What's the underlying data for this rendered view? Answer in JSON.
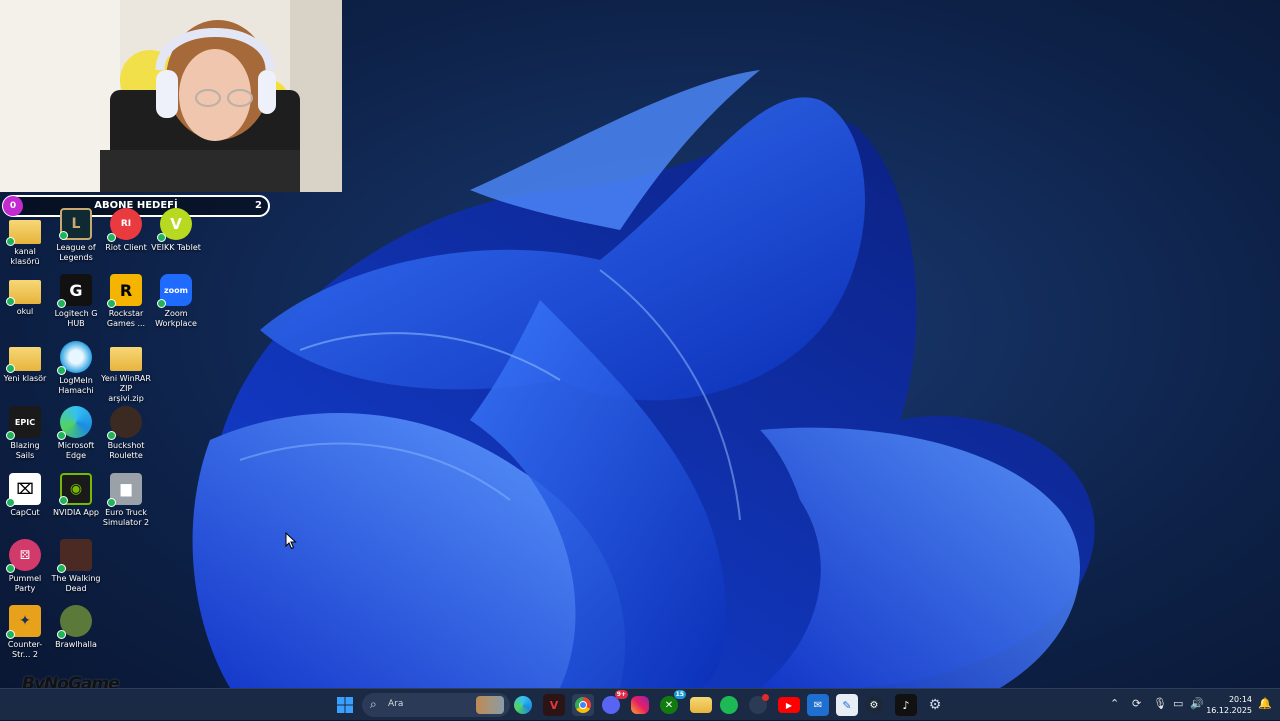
{
  "overlay": {
    "goal_start": "0",
    "goal_title": "ABONE HEDEFİ",
    "goal_end": "2"
  },
  "desktop_icons": [
    {
      "label": "kanal klasörü",
      "icon": "folder-icon"
    },
    {
      "label": "League of Legends",
      "icon": "league-of-legends-icon"
    },
    {
      "label": "Riot Client",
      "icon": "riot-client-icon"
    },
    {
      "label": "VEIKK Tablet",
      "icon": "veikk-icon"
    },
    {
      "label": "okul",
      "icon": "folder-icon"
    },
    {
      "label": "Logitech G HUB",
      "icon": "logitech-icon"
    },
    {
      "label": "Rockstar Games ...",
      "icon": "rockstar-icon"
    },
    {
      "label": "Zoom Workplace",
      "icon": "zoom-icon"
    },
    {
      "label": "Yeni klasör",
      "icon": "folder-icon"
    },
    {
      "label": "LogMeIn Hamachi",
      "icon": "hamachi-icon"
    },
    {
      "label": "Yeni WinRAR ZIP arşivi.zip",
      "icon": "zip-folder-icon"
    },
    {
      "label": "Blazing Sails",
      "icon": "epic-games-icon"
    },
    {
      "label": "Microsoft Edge",
      "icon": "edge-icon"
    },
    {
      "label": "Buckshot Roulette",
      "icon": "buckshot-icon"
    },
    {
      "label": "CapCut",
      "icon": "capcut-icon"
    },
    {
      "label": "NVIDIA App",
      "icon": "nvidia-icon"
    },
    {
      "label": "Euro Truck Simulator 2",
      "icon": "truck-icon"
    },
    {
      "label": "Pummel Party",
      "icon": "pummel-party-icon"
    },
    {
      "label": "The Walking Dead",
      "icon": "walking-dead-icon"
    },
    {
      "label": "Counter-Str... 2",
      "icon": "counter-strike-icon"
    },
    {
      "label": "Brawlhalla",
      "icon": "brawlhalla-icon"
    }
  ],
  "icon_glyphs": {
    "epic": "EPIC",
    "zoom": "zoom",
    "veikk": "V",
    "riot": "RI",
    "rockstar": "R",
    "logitech": "G"
  },
  "taskbar": {
    "search_placeholder": "Ara",
    "apps": [
      "start-icon",
      "search-field",
      "explorer-thumb-icon",
      "edge-icon",
      "terminal-icon",
      "chrome-icon",
      "discord-icon",
      "instagram-icon",
      "xbox-icon",
      "file-explorer-icon",
      "spotify-icon",
      "steam-pinned-icon",
      "youtube-icon",
      "mail-icon",
      "notepad-icon",
      "steam-icon",
      "tiktok-icon",
      "settings-icon"
    ],
    "badges": {
      "discord": "9+",
      "xbox": "15"
    },
    "time": "20:14",
    "date": "16.12.2025"
  },
  "watermark": "ByNoGame",
  "colors": {
    "taskbar": "#1b2a44",
    "accent_blue": "#1e5bff",
    "wallpaper_bg": "#0a1833"
  }
}
